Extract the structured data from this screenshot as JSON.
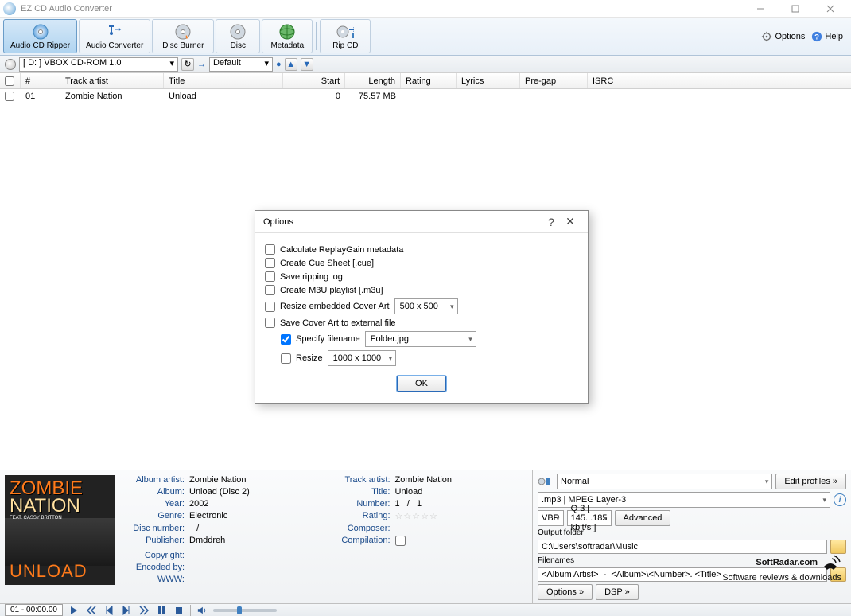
{
  "window": {
    "title": "EZ CD Audio Converter"
  },
  "toolbar": {
    "buttons": [
      {
        "label": "Audio CD Ripper"
      },
      {
        "label": "Audio Converter"
      },
      {
        "label": "Disc Burner"
      },
      {
        "label": "Disc"
      },
      {
        "label": "Metadata"
      },
      {
        "label": "Rip CD"
      }
    ],
    "options": "Options",
    "help": "Help"
  },
  "drivebar": {
    "drive": "[ D: ] VBOX CD-ROM 1.0",
    "profile": "Default"
  },
  "table": {
    "headers": [
      "#",
      "Track artist",
      "Title",
      "Start",
      "Length",
      "Rating",
      "Lyrics",
      "Pre-gap",
      "ISRC"
    ],
    "row": {
      "num": "01",
      "artist": "Zombie Nation",
      "title": "Unload",
      "start": "0",
      "length": "75.57 MB"
    }
  },
  "dialog": {
    "title": "Options",
    "opts": {
      "replaygain": "Calculate ReplayGain metadata",
      "cue": "Create Cue Sheet [.cue]",
      "log": "Save ripping log",
      "m3u": "Create M3U playlist [.m3u]",
      "resize_cover": "Resize embedded Cover Art",
      "resize_cover_val": "500 x 500",
      "save_cover": "Save Cover Art to external file",
      "specify_fn": "Specify filename",
      "specify_fn_val": "Folder.jpg",
      "resize2": "Resize",
      "resize2_val": "1000 x 1000"
    },
    "ok": "OK"
  },
  "meta": {
    "labels": {
      "album_artist": "Album artist:",
      "album": "Album:",
      "year": "Year:",
      "genre": "Genre:",
      "disc_number": "Disc number:",
      "publisher": "Publisher:",
      "copyright": "Copyright:",
      "encoded_by": "Encoded by:",
      "www": "WWW:",
      "track_artist": "Track artist:",
      "title": "Title:",
      "number": "Number:",
      "rating": "Rating:",
      "composer": "Composer:",
      "compilation": "Compilation:"
    },
    "values": {
      "album_artist": "Zombie Nation",
      "album": "Unload (Disc 2)",
      "year": "2002",
      "genre": "Electronic",
      "disc_number_sep": "/",
      "publisher": "Dmddreh",
      "track_artist": "Zombie Nation",
      "title": "Unload",
      "number": "1",
      "number_sep": "/",
      "number_total": "1"
    }
  },
  "encode": {
    "profile": "Normal",
    "edit_profiles": "Edit profiles »",
    "format": ".mp3 | MPEG Layer-3",
    "mode": "VBR",
    "quality": "Q 3  [ 145...185 kbit/s ]",
    "advanced": "Advanced",
    "output_folder_label": "Output folder",
    "output_folder": "C:\\Users\\softradar\\Music",
    "filenames_label": "Filenames",
    "filenames": "<Album Artist>  -  <Album>\\<Number>. <Title>",
    "options_btn": "Options »",
    "dsp_btn": "DSP »"
  },
  "playbar": {
    "position": "01 - 00:00.00"
  },
  "watermark": {
    "brand": "SoftRadar.com",
    "tagline": "Software reviews & downloads"
  }
}
